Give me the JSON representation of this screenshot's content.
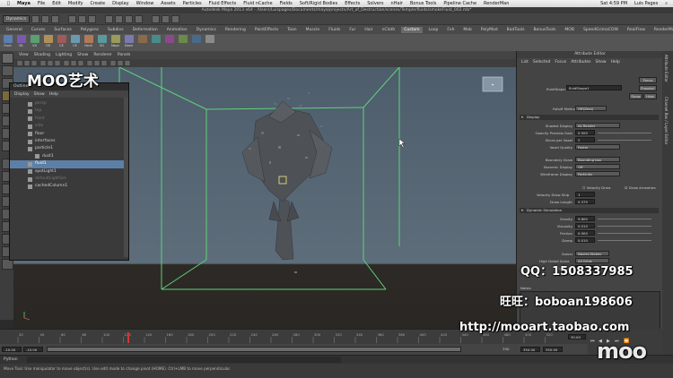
{
  "menubar": {
    "items": [
      "Maya",
      "File",
      "Edit",
      "Modify",
      "Create",
      "Display",
      "Window",
      "Assets",
      "Particles",
      "Fluid Effects",
      "Fluid nCache",
      "Fields",
      "Soft/Rigid Bodies",
      "Effects",
      "Solvers",
      "nHair",
      "Bonus Tools",
      "Pipeline Cache",
      "RenderMan"
    ],
    "time": "Sat 4:59 PM",
    "user": "Luis Pages"
  },
  "window_title": "Autodesk Maya 2013 x64 - /Users/Luispages/Documents/maya/projects/Art_of_Destruction/scenes/Temple/fluids/smokeFluid_002.mb*",
  "status": {
    "mode": "Dynamics"
  },
  "shelf": {
    "tabs": [
      "General",
      "Curves",
      "Surfaces",
      "Polygons",
      "Subdivs",
      "Deformation",
      "Animation",
      "Dynamics",
      "Rendering",
      "PaintEffects",
      "Toon",
      "Muscle",
      "Fluids",
      "Fur",
      "Hair",
      "nCloth",
      "Custom",
      "Loop",
      "Fxh",
      "Mob",
      "PolyMod",
      "BadTools",
      "BonusTools",
      "MOB",
      "SpeedGrimaCOW",
      "RealFlow",
      "RenderMan"
    ],
    "active_tab": "Custom",
    "icons": [
      "Ouct",
      "Dt",
      "VS",
      "OS",
      "CE",
      "CE",
      "Hndl",
      "SG",
      "Nspn",
      "Desh",
      "",
      "",
      "",
      "",
      "",
      ""
    ]
  },
  "viewport": {
    "menus": [
      "View",
      "Shading",
      "Lighting",
      "Show",
      "Renderer",
      "Panels"
    ]
  },
  "outliner": {
    "title": "Outliner",
    "menus": [
      "Display",
      "Show",
      "Help"
    ],
    "items": [
      {
        "label": "persp",
        "state": "dim"
      },
      {
        "label": "top",
        "state": "dim"
      },
      {
        "label": "front",
        "state": "dim"
      },
      {
        "label": "side",
        "state": "dim"
      },
      {
        "label": "floor",
        "state": "normal"
      },
      {
        "label": "interfaces",
        "state": "normal"
      },
      {
        "label": "particle1",
        "state": "normal"
      },
      {
        "label": "dust1",
        "state": "normal",
        "indent": true
      },
      {
        "label": "fluid1",
        "state": "selected"
      },
      {
        "label": "spotLight1",
        "state": "normal"
      },
      {
        "label": "defaultLightSet",
        "state": "dim"
      },
      {
        "label": "cachedColumn1",
        "state": "normal"
      }
    ]
  },
  "attribute_editor": {
    "title": "Attribute Editor",
    "menus": [
      "List",
      "Selected",
      "Focus",
      "Attributes",
      "Show",
      "Help"
    ],
    "node_label": "fluidShape:",
    "node_value": "fluidShape1",
    "focus_btn": "Focus",
    "presets_btn": "Presets*",
    "show_btn": "Show",
    "hide_btn": "Hide",
    "falloff_label": "Falloff Method",
    "falloff_value": "Off(Zero)",
    "display_section": "Display",
    "rows": [
      {
        "label": "Shaded Display",
        "value": "As Render",
        "kind": "drop"
      },
      {
        "label": "Opacity Preview Gain",
        "value": "0.500",
        "kind": "field"
      },
      {
        "label": "Slices per Voxel",
        "value": "2",
        "kind": "field"
      },
      {
        "label": "Voxel Quality",
        "value": "Faster",
        "kind": "drop"
      },
      {
        "label": "Boundary Draw",
        "value": "Bounding box",
        "kind": "drop"
      },
      {
        "label": "Numeric Display",
        "value": "Off",
        "kind": "drop"
      },
      {
        "label": "Wireframe Display",
        "value": "Particles",
        "kind": "drop"
      }
    ],
    "velocity_draw": "Velocity Draw",
    "draw_arrowheads": "Draw Arrowhea",
    "velocity_skip_label": "Velocity Draw Skip",
    "velocity_skip_value": "1",
    "draw_length_label": "Draw Length",
    "draw_length_value": "0.375",
    "dynamic_section": "Dynamic Simulation",
    "dyn_rows": [
      {
        "label": "Gravity",
        "value": "9.800"
      },
      {
        "label": "Viscosity",
        "value": "0.010"
      },
      {
        "label": "Friction",
        "value": "0.000"
      },
      {
        "label": "Damp",
        "value": "0.010"
      }
    ],
    "solver_label": "Solver",
    "solver_value": "Navier-Stokes",
    "high_detail_label": "High Detail Solve",
    "high_detail_value": "All Grids",
    "substeps_label": "Substeps",
    "notes_label": "Notes:"
  },
  "vertical_tabs": [
    "Attribute Editor",
    "Channel Box / Layer Editor"
  ],
  "timeslider": {
    "ticks": [
      "20",
      "40",
      "60",
      "80",
      "100",
      "120",
      "140",
      "160",
      "180",
      "200",
      "220",
      "240",
      "260",
      "280",
      "300",
      "320",
      "340",
      "360",
      "380",
      "400",
      "420",
      "440",
      "460",
      "480",
      "500",
      "520"
    ],
    "current_frame": "30.00"
  },
  "range": {
    "start": "-10.00",
    "start2": "-10.00",
    "end1": "350",
    "end2": "350.00",
    "end3": "350.00",
    "current": "30.00"
  },
  "command": {
    "lang": "Python"
  },
  "help_text": "Move Tool: Use manipulator to move object(s). Use edit mode to change pivot (HOME). Ctrl+LMB to move perpendicular.",
  "watermarks": {
    "logo": "MOO艺术",
    "qq": "QQ：1508337985",
    "wangwang": "旺旺：boboan198606",
    "url": "http://mooart.taobao.com",
    "moo": "moo"
  },
  "colors": {
    "selection": "#5c7fa8",
    "wire": "#5fd27a",
    "accent_blue": "#4a7fd4"
  }
}
